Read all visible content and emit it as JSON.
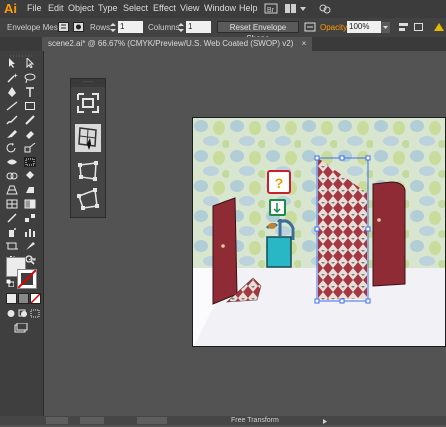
{
  "app": {
    "logo": "Ai"
  },
  "menu": [
    "File",
    "Edit",
    "Object",
    "Type",
    "Select",
    "Effect",
    "View",
    "Window",
    "Help"
  ],
  "control_bar": {
    "mode_label": "Envelope Mesh",
    "rows_label": "Rows:",
    "rows_value": "1",
    "columns_label": "Columns:",
    "columns_value": "1",
    "reset_button": "Reset Envelope Shape",
    "opacity_label": "Opacity:",
    "opacity_value": "100%"
  },
  "document_tab": {
    "title": "scene2.ai* @ 66.67% (CMYK/Preview/U.S. Web Coated (SWOP) v2)",
    "close": "×"
  },
  "envelope_panel": {
    "grip": "·····"
  },
  "status": {
    "text": "Free Transform"
  },
  "colors": {
    "accent": "#ff9a00",
    "wall": "#c9ddc0",
    "door": "#8e2b35",
    "argyle": "#a33844",
    "floor": "#f2f1f6"
  }
}
